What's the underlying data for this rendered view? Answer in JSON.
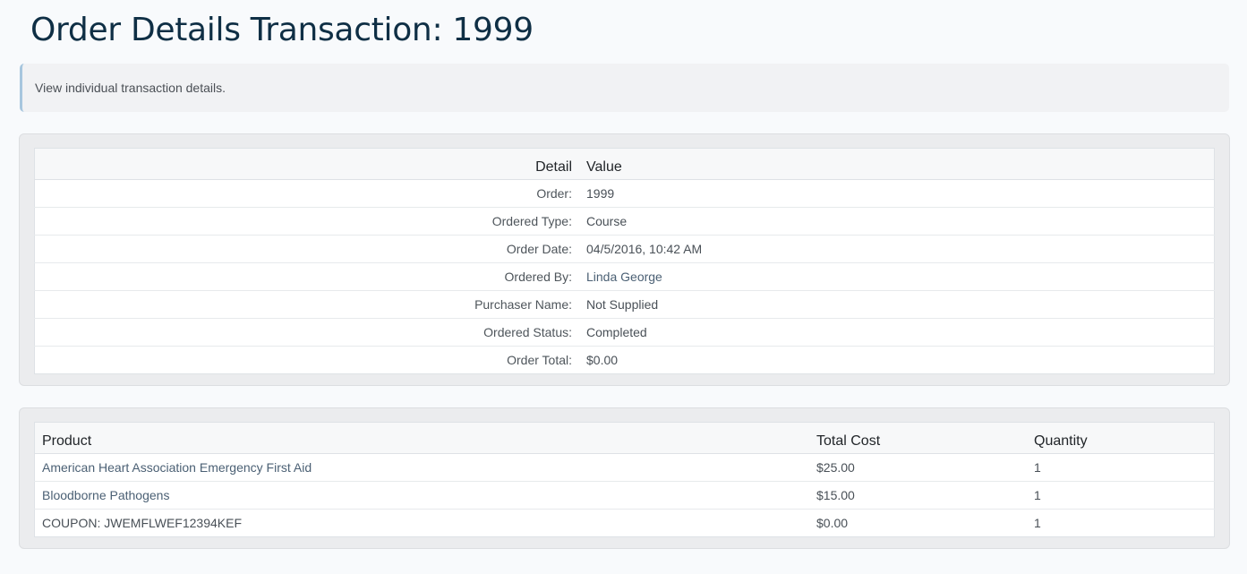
{
  "page": {
    "title": "Order Details Transaction: 1999",
    "description": "View individual transaction details."
  },
  "details": {
    "headers": {
      "detail": "Detail",
      "value": "Value"
    },
    "rows": [
      {
        "label": "Order:",
        "value": "1999"
      },
      {
        "label": "Ordered Type:",
        "value": "Course"
      },
      {
        "label": "Order Date:",
        "value": "04/5/2016, 10:42 AM"
      },
      {
        "label": "Ordered By:",
        "value": "Linda George"
      },
      {
        "label": "Purchaser Name:",
        "value": "Not Supplied"
      },
      {
        "label": "Ordered Status:",
        "value": "Completed"
      },
      {
        "label": "Order Total:",
        "value": "$0.00"
      }
    ]
  },
  "products": {
    "headers": {
      "product": "Product",
      "total_cost": "Total Cost",
      "quantity": "Quantity"
    },
    "rows": [
      {
        "product": "American Heart Association Emergency First Aid",
        "total_cost": "$25.00",
        "quantity": "1"
      },
      {
        "product": "Bloodborne Pathogens",
        "total_cost": "$15.00",
        "quantity": "1"
      },
      {
        "product": "COUPON: JWEMFLWEF12394KEF",
        "total_cost": "$0.00",
        "quantity": "1"
      }
    ]
  },
  "colors": {
    "title": "#0f2f45",
    "link": "#4b6074",
    "callout_border": "#a7c6de",
    "page_bg": "#f8fafc"
  }
}
